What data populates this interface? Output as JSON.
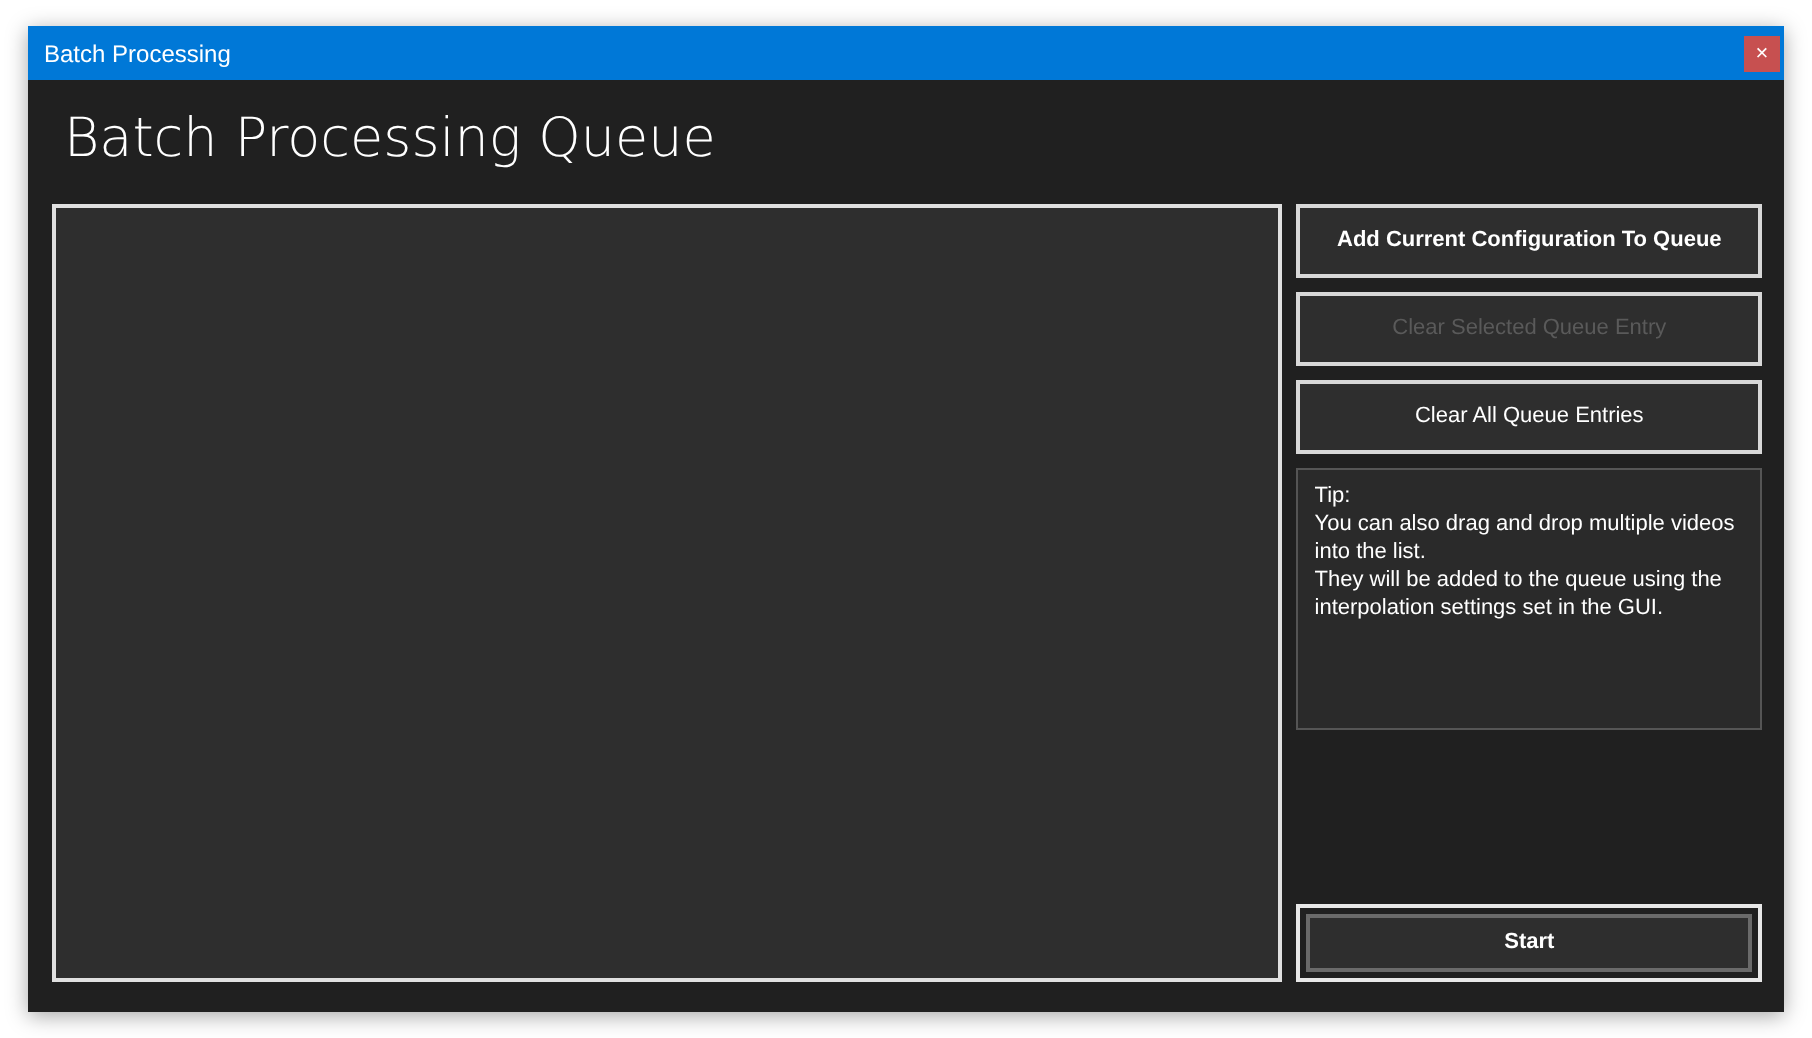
{
  "window": {
    "title": "Batch Processing",
    "close": "×"
  },
  "heading": "Batch Processing Queue",
  "actions": [
    {
      "label": "Add Current Configuration To Queue",
      "kind": "bold",
      "disabled": false
    },
    {
      "label": "Clear Selected Queue Entry",
      "kind": "plain",
      "disabled": true
    },
    {
      "label": "Clear All Queue Entries",
      "kind": "plain",
      "disabled": false
    }
  ],
  "tip": [
    "Tip:",
    "You can also drag and drop multiple videos into the list.",
    "They will be added to the queue using the interpolation settings set in the GUI."
  ],
  "start_button": {
    "label": "Start"
  }
}
